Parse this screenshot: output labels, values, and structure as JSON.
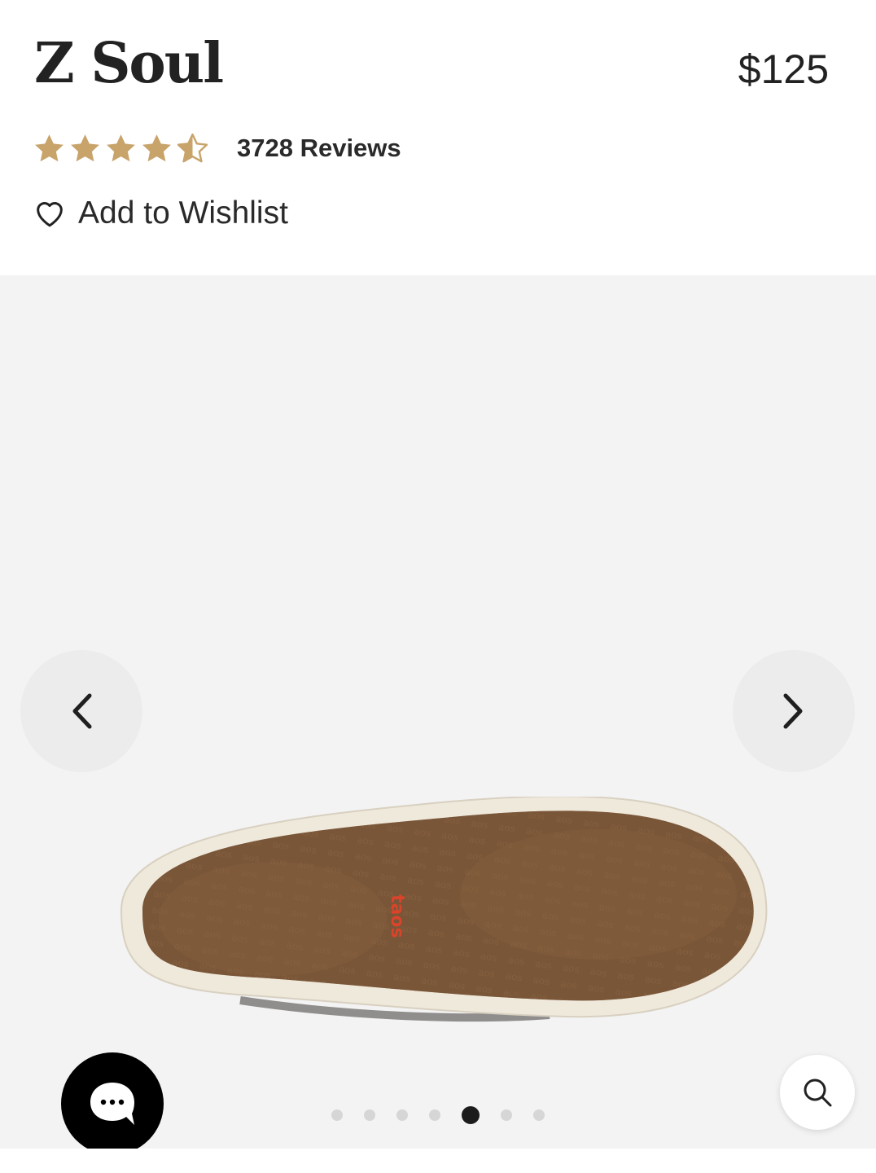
{
  "product": {
    "title": "Z Soul",
    "price": "$125",
    "rating": 4.5,
    "rating_max": 5,
    "reviews_label": "3728 Reviews",
    "wishlist_label": "Add to Wishlist"
  },
  "gallery": {
    "image_subject": "shoe-sole",
    "sole_logo_text": "taos",
    "current_slide": 5,
    "total_slides": 7,
    "prev_icon": "chevron-left-icon",
    "next_icon": "chevron-right-icon"
  },
  "widgets": {
    "chat_icon": "chat-bubble-icon",
    "search_icon": "search-icon"
  },
  "colors": {
    "star": "#c8a36a",
    "accent_dark": "#1c1c1c",
    "gallery_bg": "#f3f3f3",
    "sole_brown": "#7a5638",
    "sole_rim": "#efe9dc",
    "logo_red": "#d9442b"
  }
}
